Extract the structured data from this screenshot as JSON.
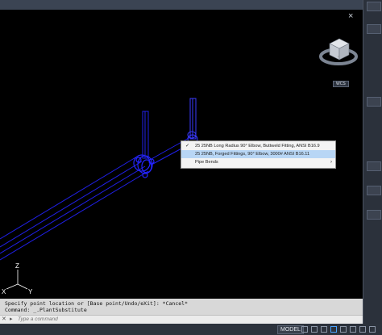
{
  "viewport": {
    "wcs_label": "WCS",
    "ucs": {
      "z_label": "Z",
      "x_label": "X",
      "y_label": "Y"
    }
  },
  "context_menu": {
    "items": [
      {
        "label": "25 25NB Long Radius 90° Elbow, Buttweld Fitting, ANSI B16.9",
        "checked": true,
        "highlighted": false
      },
      {
        "label": "25 25NB, Forged Fittings, 90° Elbow, 3000# ANSI B16.11",
        "checked": false,
        "highlighted": true
      },
      {
        "label": "Pipe Bends",
        "checked": false,
        "highlighted": false,
        "has_submenu": true
      }
    ],
    "submenu_arrow": "›",
    "check_mark": "✓"
  },
  "command_line": {
    "history": [
      "Specify point location or [Base point/Undo/eXit]: *Cancel*",
      "Command: _.PlantSubstitute"
    ],
    "input_placeholder": "Type a command",
    "close_symbol": "✕",
    "prompt_symbol": "▸"
  },
  "status_bar": {
    "model_label": "MODEL"
  },
  "colors": {
    "pipe": "#2020e8",
    "pipe_highlight": "#4a4aff",
    "background": "#000000"
  }
}
